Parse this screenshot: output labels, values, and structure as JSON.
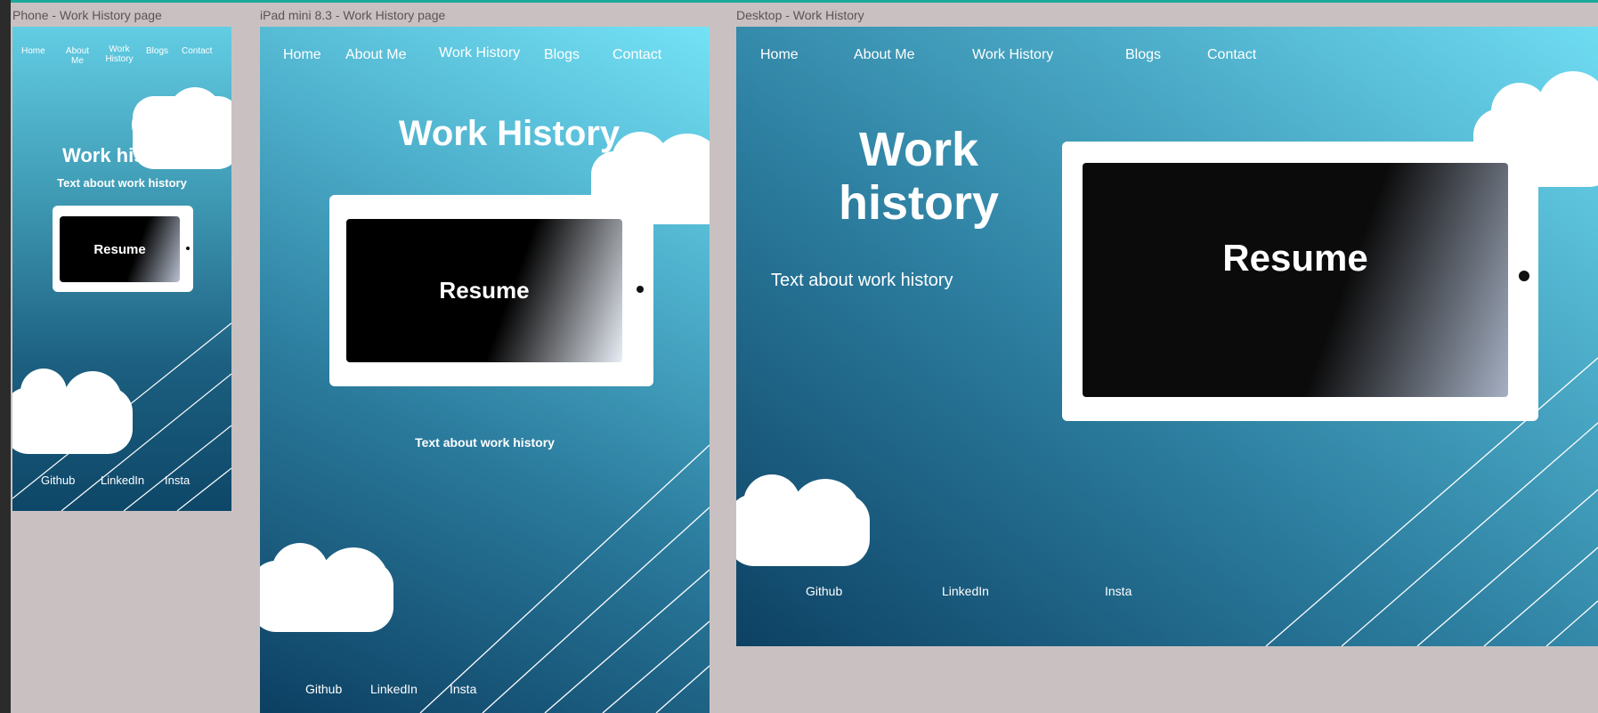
{
  "colors": {
    "canvas_bg": "#c9c1c1",
    "gradient_top": "#6fdcf2",
    "gradient_bottom": "#0b3f5f",
    "cloud": "#ffffff",
    "screen_black": "#0b0b0b"
  },
  "phone": {
    "frame_label": "Phone - Work History page",
    "nav": [
      "Home",
      "About Me",
      "Work History",
      "Blogs",
      "Contact"
    ],
    "title": "Work history",
    "subtitle": "Text about work history",
    "resume_label": "Resume",
    "footer": [
      "Github",
      "LinkedIn",
      "Insta"
    ]
  },
  "ipad": {
    "frame_label": "iPad mini 8.3 - Work History page",
    "nav": [
      "Home",
      "About Me",
      "Work History",
      "Blogs",
      "Contact"
    ],
    "title": "Work History",
    "resume_label": "Resume",
    "subtitle": "Text about work history",
    "footer": [
      "Github",
      "LinkedIn",
      "Insta"
    ]
  },
  "desktop": {
    "frame_label": "Desktop - Work History",
    "nav": [
      "Home",
      "About Me",
      "Work History",
      "Blogs",
      "Contact"
    ],
    "title_line1": "Work",
    "title_line2": "history",
    "subtitle": "Text about work history",
    "resume_label": "Resume",
    "footer": [
      "Github",
      "LinkedIn",
      "Insta"
    ]
  },
  "icons": [
    "cloud-icon",
    "tablet-camera-dot-icon"
  ]
}
